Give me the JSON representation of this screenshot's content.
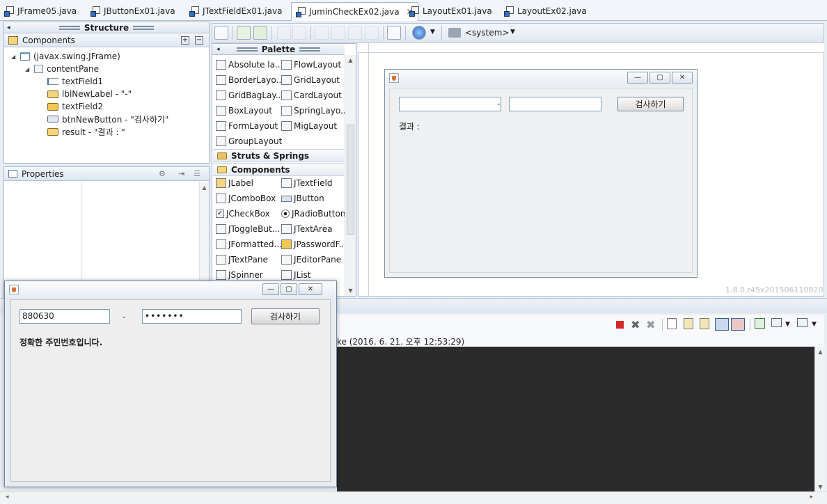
{
  "tabs": [
    {
      "label": "JFrame05.java"
    },
    {
      "label": "JButtonEx01.java"
    },
    {
      "label": "JTextFieldEx01.java"
    },
    {
      "label": "JuminCheckEx02.java",
      "active": true
    },
    {
      "label": "LayoutEx01.java"
    },
    {
      "label": "LayoutEx02.java"
    }
  ],
  "structure": {
    "title": "Structure",
    "components_label": "Components",
    "tree": [
      {
        "label": "(javax.swing.JFrame)",
        "level": 0,
        "icon": "frame-icon"
      },
      {
        "label": "contentPane",
        "level": 1,
        "icon": "panel-icon"
      },
      {
        "label": "textField1",
        "level": 2,
        "icon": "textfield-icon"
      },
      {
        "label": "lblNewLabel - \"-\"",
        "level": 2,
        "icon": "label-icon"
      },
      {
        "label": "textField2",
        "level": 2,
        "icon": "password-icon"
      },
      {
        "label": "btnNewButton - \"검사하기\"",
        "level": 2,
        "icon": "button-icon"
      },
      {
        "label": "result - \"결과 : \"",
        "level": 2,
        "icon": "label-icon"
      }
    ],
    "properties_label": "Properties"
  },
  "toolbar": {
    "system_label": "<system>"
  },
  "palette": {
    "title": "Palette",
    "layouts": [
      "Absolute la...",
      "FlowLayout",
      "BorderLayo...",
      "GridLayout",
      "GridBagLay...",
      "CardLayout",
      "BoxLayout",
      "SpringLayo...",
      "FormLayout",
      "MigLayout",
      "GroupLayout"
    ],
    "cat_struts": "Struts & Springs",
    "cat_components": "Components",
    "components": [
      "JLabel",
      "JTextField",
      "JComboBox",
      "JButton",
      "JCheckBox",
      "JRadioButton",
      "JToggleBut...",
      "JTextArea",
      "JFormatted...",
      "JPasswordF...",
      "JTextPane",
      "JEditorPane",
      "JSpinner",
      "JList"
    ]
  },
  "design": {
    "dash": "-",
    "button": "검사하기",
    "result": "결과 :",
    "version": "1.8.0.r45x201506110820"
  },
  "console": {
    "header_partial": "ke (2016. 6. 21. 오후 12:53:29)"
  },
  "running": {
    "field1": "880630",
    "dash": "-",
    "field2": "•••••••",
    "button": "검사하기",
    "result": "정확한 주민번호입니다."
  }
}
